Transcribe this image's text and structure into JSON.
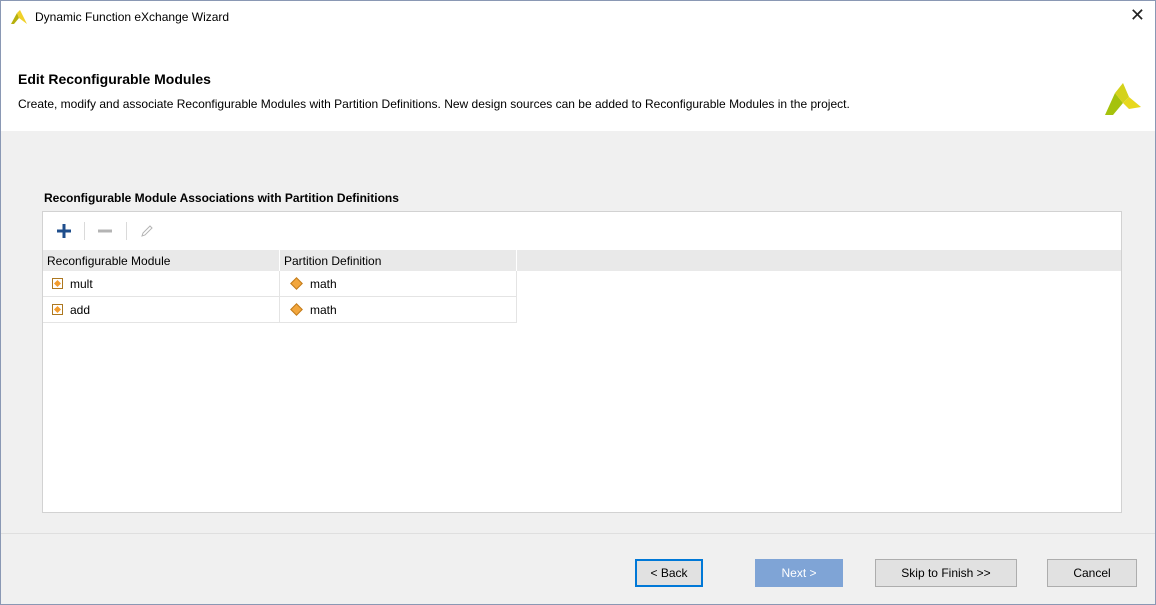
{
  "window": {
    "title": "Dynamic Function eXchange Wizard",
    "close_glyph": "✕",
    "app_icon": "xilinx-logo-icon"
  },
  "header": {
    "title": "Edit Reconfigurable Modules",
    "description": "Create, modify and associate Reconfigurable Modules with Partition Definitions. New design sources can be added to Reconfigurable Modules in the project."
  },
  "section": {
    "label": "Reconfigurable Module Associations with Partition Definitions"
  },
  "toolbar": {
    "add_icon": "plus-icon",
    "remove_icon": "minus-icon",
    "edit_icon": "pencil-icon"
  },
  "table": {
    "columns": [
      "Reconfigurable Module",
      "Partition Definition"
    ],
    "rows": [
      {
        "module": "mult",
        "partition": "math"
      },
      {
        "module": "add",
        "partition": "math"
      }
    ]
  },
  "buttons": {
    "back": "< Back",
    "next": "Next >",
    "skip": "Skip to Finish >>",
    "cancel": "Cancel"
  },
  "colors": {
    "accent": "#0078d7",
    "next_button": "#7fa4d6",
    "module_icon": "#f39c2d",
    "logo_green": "#a5c20c",
    "logo_yellow": "#e7d81d"
  }
}
